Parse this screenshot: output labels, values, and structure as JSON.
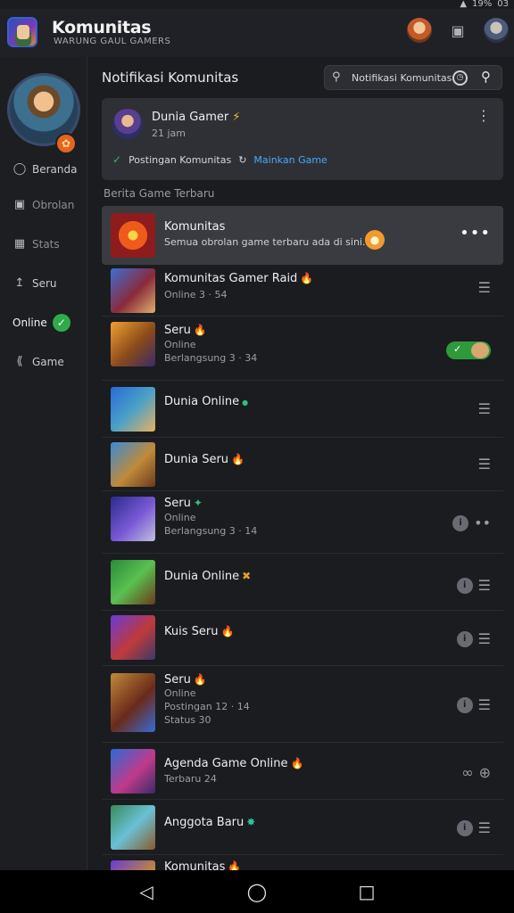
{
  "status": {
    "battery": "19%",
    "time": "03"
  },
  "topbar": {
    "title": "Komunitas",
    "subtitle": "WARUNG GAUL GAMERS"
  },
  "sidebar": {
    "items": [
      {
        "label": "Beranda"
      },
      {
        "label": "Obrolan"
      },
      {
        "label": "Stats"
      },
      {
        "label": "Seru"
      },
      {
        "label": "Online"
      },
      {
        "label": "Game"
      }
    ]
  },
  "main": {
    "header": "Notifikasi Komunitas",
    "search_text": "Notifikasi Komunitas",
    "post": {
      "title": "Dunia Gamer",
      "meta": "21 jam",
      "footer_text": "Postingan Komunitas",
      "footer_link": "Mainkan Game"
    },
    "section_label": "Berita Game Terbaru",
    "featured": {
      "title": "Komunitas",
      "desc": "Semua obrolan game terbaru ada di sini."
    },
    "rows": [
      {
        "name": "Komunitas Gamer Raid",
        "emoji": "🔥",
        "sub": [
          "Online 3 · 54"
        ]
      },
      {
        "name": "Seru",
        "emoji": "🔥",
        "sub": [
          "Online",
          "Berlangsung 3 · 34"
        ]
      },
      {
        "name": "Dunia Online",
        "emoji": "●",
        "sub": []
      },
      {
        "name": "Dunia Seru",
        "emoji": "🔥",
        "sub": []
      },
      {
        "name": "Seru",
        "emoji": "✦",
        "sub": [
          "Online",
          "Berlangsung 3 · 14"
        ]
      },
      {
        "name": "Dunia Online",
        "emoji": "✖",
        "sub": []
      },
      {
        "name": "Kuis Seru",
        "emoji": "🔥",
        "sub": []
      },
      {
        "name": "Seru",
        "emoji": "🔥",
        "sub": [
          "Online",
          "Postingan 12 · 14",
          "Status 30"
        ]
      },
      {
        "name": "Agenda Game Online",
        "emoji": "🔥",
        "sub": [
          "Terbaru 24"
        ]
      },
      {
        "name": "Anggota Baru",
        "emoji": "✸",
        "sub": []
      },
      {
        "name": "Komunitas",
        "emoji": "🔥",
        "sub": []
      }
    ]
  }
}
